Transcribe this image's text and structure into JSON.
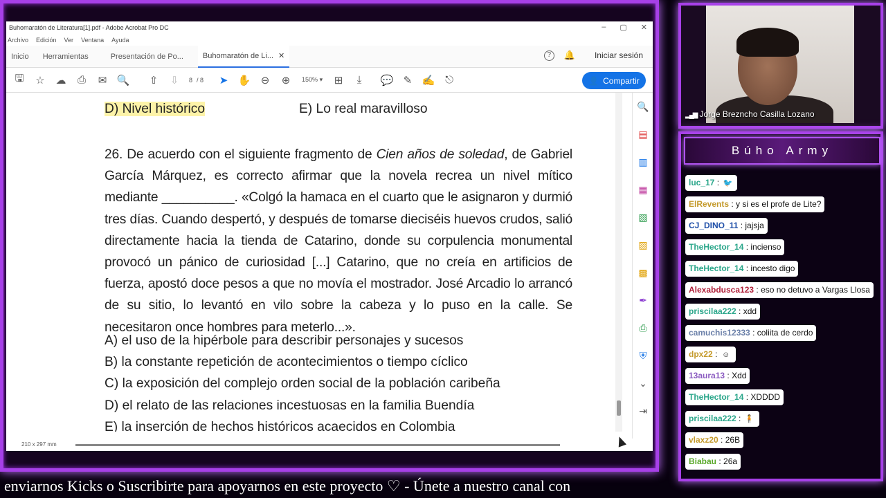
{
  "window": {
    "title": "Buhomaratón de Literatura[1].pdf - Adobe Acrobat Pro DC",
    "controls": [
      "–",
      "▢",
      "✕"
    ]
  },
  "menu": [
    "Archivo",
    "Edición",
    "Ver",
    "Ventana",
    "Ayuda"
  ],
  "tabs": [
    {
      "label": "Inicio"
    },
    {
      "label": "Herramientas"
    },
    {
      "label": "Presentación de Po..."
    },
    {
      "label": "Buhomaratón de Li...",
      "active": true
    }
  ],
  "tabbar_right": {
    "help": "?",
    "bell": "🔔",
    "signin": "Iniciar sesión"
  },
  "toolbar": {
    "page_current": "8",
    "page_total": "/ 8",
    "zoom": "150%",
    "share_label": "Compartir"
  },
  "document": {
    "prev_option_d": "D) Nivel histórico",
    "prev_option_e": "E) Lo real maravilloso",
    "question_prefix": "26. De acuerdo con el siguiente fragmento de ",
    "question_book": "Cien años de soledad",
    "question_rest": ", de Gabriel García Márquez, es correcto afirmar que la novela recrea un nivel mítico mediante __________. «Colgó la hamaca en el cuarto que le asignaron y durmió tres días. Cuando despertó, y después de tomarse dieciséis huevos crudos, salió directamente hacia la tienda de Catarino, donde su corpulencia monumental provocó un pánico de curiosidad [...] Catarino, que no creía en artificios de fuerza, apostó doce pesos a que no movía el mostrador. José Arcadio lo arrancó de su sitio, lo levantó en vilo sobre la cabeza y lo puso en la calle. Se necesitaron once hombres para meterlo...».",
    "options": [
      "A) el uso de la hipérbole para describir personajes y sucesos",
      "B) la constante repetición de acontecimientos o tiempo cíclico",
      "C) la exposición del complejo orden social de la población caribeña",
      "D) el relato de las relaciones incestuosas en la familia Buendía",
      "E) la inserción de hechos históricos acaecidos en Colombia"
    ],
    "page_size": "210 x 297 mm"
  },
  "webcam": {
    "name": "Jorge Breznchо Casilla Lozano"
  },
  "chat": {
    "title": "Búho Army",
    "messages": [
      {
        "user": "luc_17",
        "text": "",
        "emote": "🐦",
        "color": "#2aa68a"
      },
      {
        "user": "ElRevents",
        "text": "y si es el profe de Lite?",
        "color": "#c49a2c"
      },
      {
        "user": "CJ_DINO_11",
        "text": "jajsja",
        "color": "#1f4fa8"
      },
      {
        "user": "TheHector_14",
        "text": "incienso",
        "color": "#2aa68a"
      },
      {
        "user": "TheHector_14",
        "text": "incesto digo",
        "color": "#2aa68a"
      },
      {
        "user": "Alexabdusca123",
        "text": "eso no detuvo a Vargas Llosa",
        "color": "#b0203a"
      },
      {
        "user": "priscilaa222",
        "text": "xdd",
        "color": "#2aa68a"
      },
      {
        "user": "camuchis12333",
        "text": "coliita de cerdo",
        "color": "#6a7fa8"
      },
      {
        "user": "dpx22",
        "text": "",
        "emote": "☺",
        "color": "#c49a2c"
      },
      {
        "user": "13aura13",
        "text": "Xdd",
        "color": "#8a5ac0"
      },
      {
        "user": "TheHector_14",
        "text": "XDDDD",
        "color": "#2aa68a"
      },
      {
        "user": "priscilaa222",
        "text": "",
        "emote": "🧍",
        "color": "#2aa68a"
      },
      {
        "user": "vlaxz20",
        "text": "26B",
        "color": "#c49a2c"
      },
      {
        "user": "Biabau",
        "text": "26a",
        "color": "#5aa82a"
      }
    ]
  },
  "ticker": "enviarnos Kicks o Suscribirte para apoyarnos en este proyecto ♡  -  Únete a nuestro canal con"
}
